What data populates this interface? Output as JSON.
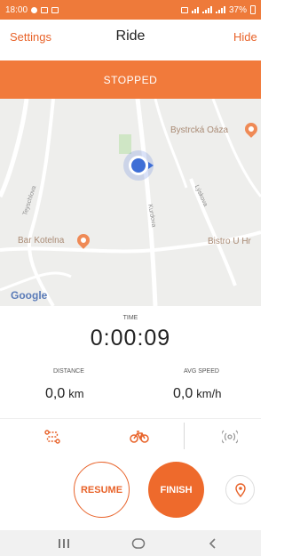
{
  "status_bar": {
    "time": "18:00",
    "battery": "37%",
    "color": "#ee7a3a"
  },
  "header": {
    "settings_label": "Settings",
    "title": "Ride",
    "hide_label": "Hide"
  },
  "banner": {
    "status": "STOPPED",
    "color": "#f17a3b"
  },
  "map": {
    "places": [
      "Bystrcká Oáza",
      "Bar Kotelna",
      "Bistro U Hr"
    ],
    "streets": [
      "Teyschlova",
      "Kurdova",
      "Lýskova"
    ],
    "attribution": "Google"
  },
  "time": {
    "label": "TIME",
    "value": "0:00:09"
  },
  "distance": {
    "label": "DISTANCE",
    "value": "0,0",
    "unit": "km"
  },
  "avg_speed": {
    "label": "AVG SPEED",
    "value": "0,0",
    "unit": "km/h"
  },
  "icon_bar": {
    "icons": [
      "route-icon",
      "bicycle-icon",
      "sensor-icon"
    ]
  },
  "controls": {
    "resume_label": "RESUME",
    "finish_label": "FINISH",
    "accent": "#e8632a"
  },
  "nav_bar": {
    "icons": [
      "recent-apps-icon",
      "home-icon",
      "back-icon"
    ]
  }
}
